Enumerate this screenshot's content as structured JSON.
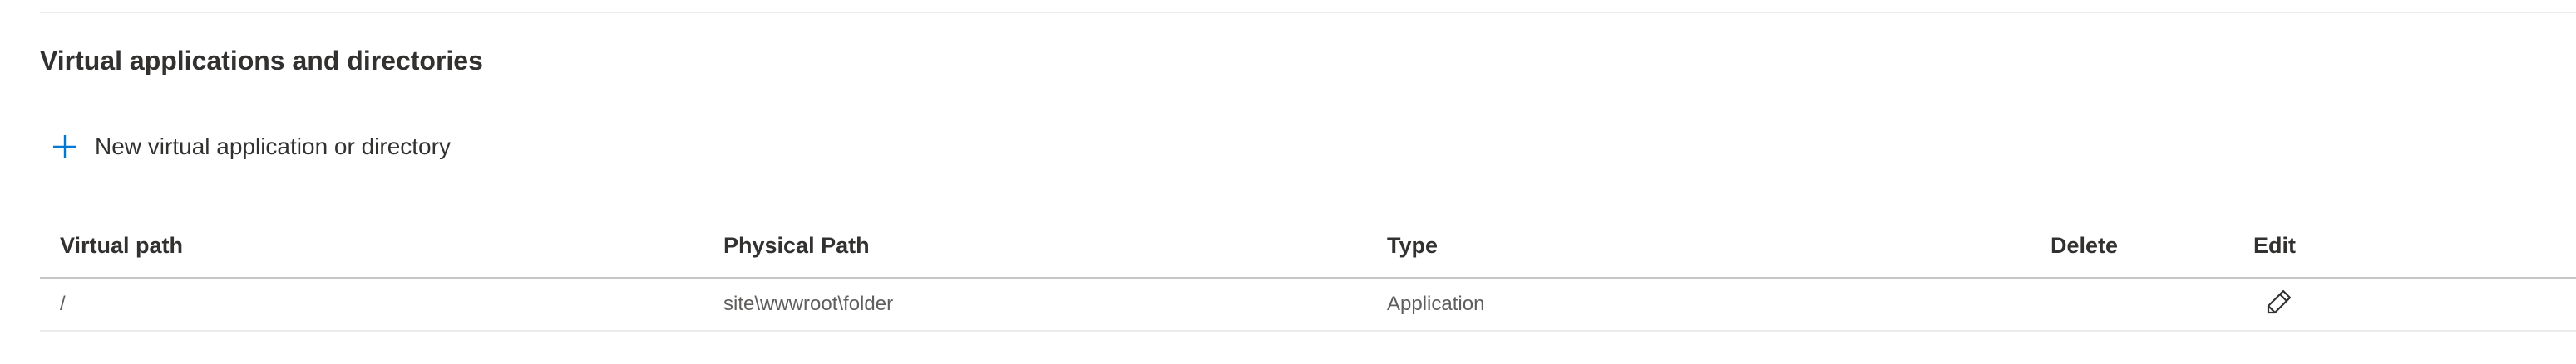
{
  "section": {
    "title": "Virtual applications and directories"
  },
  "toolbar": {
    "add_label": "New virtual application or directory",
    "add_icon": "plus-icon",
    "accent_color": "#0078d4"
  },
  "table": {
    "columns": [
      "Virtual path",
      "Physical Path",
      "Type",
      "Delete",
      "Edit"
    ],
    "rows": [
      {
        "virtual_path": "/",
        "physical_path": "site\\wwwroot\\folder",
        "type": "Application",
        "delete": "",
        "edit_icon": "pencil-icon"
      }
    ]
  }
}
